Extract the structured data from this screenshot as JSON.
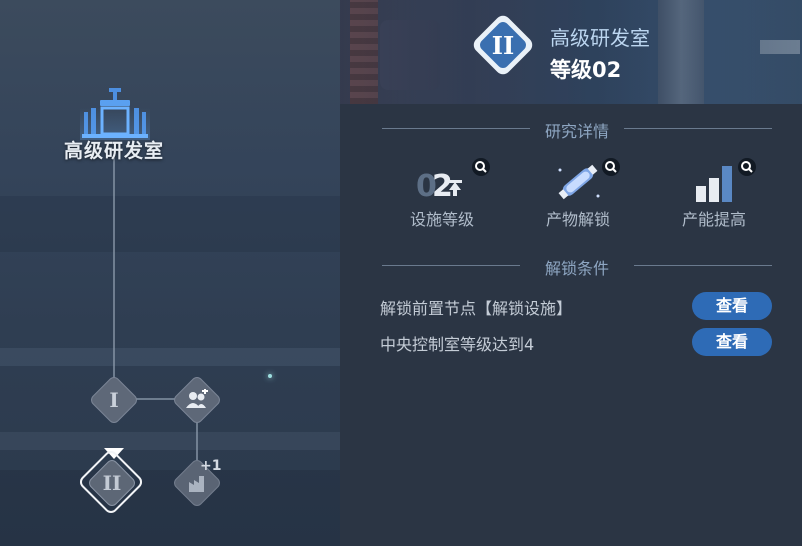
{
  "tree": {
    "building_name": "高级研发室",
    "nodes": [
      {
        "roman": "I",
        "state": "unlocked"
      },
      {
        "icon": "personnel-icon",
        "state": "unlocked"
      },
      {
        "roman": "II",
        "state": "selected"
      },
      {
        "icon": "production-icon",
        "badge": "+1",
        "state": "locked"
      }
    ]
  },
  "panel": {
    "title": "高级研发室",
    "level_text": "等级02",
    "level_roman": "II",
    "research_header": "研究详情",
    "features": [
      {
        "label": "设施等级",
        "icon": "facility-level-icon",
        "icon_text": "02"
      },
      {
        "label": "产物解锁",
        "icon": "product-unlock-icon"
      },
      {
        "label": "产能提高",
        "icon": "capacity-increase-icon"
      }
    ],
    "unlock_header": "解锁条件",
    "conditions": [
      {
        "text": "解锁前置节点【解锁设施】",
        "button": "查看"
      },
      {
        "text": "中央控制室等级达到4",
        "button": "查看"
      }
    ]
  },
  "colors": {
    "accent_blue": "#2e6bb6",
    "title_blue": "#bcd6f0",
    "section_header": "#8ea6c2"
  }
}
